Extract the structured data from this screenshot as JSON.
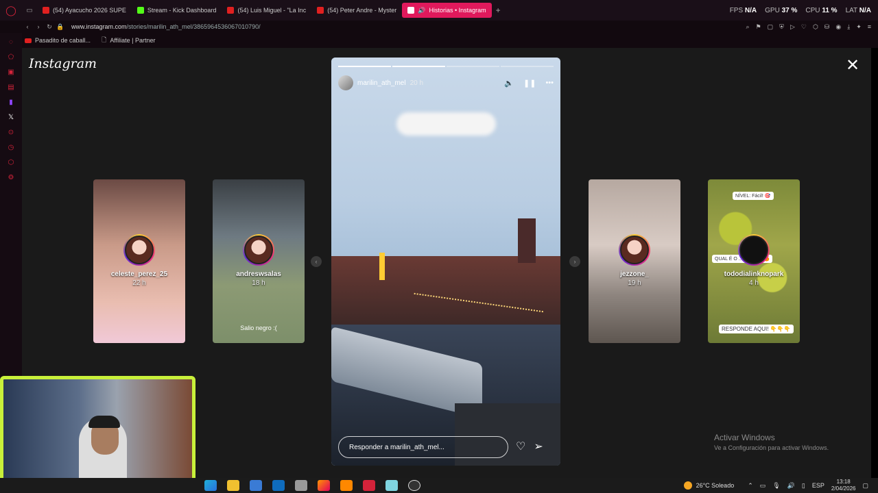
{
  "tabs": [
    {
      "label": "(54) Ayacucho 2026 SUPE",
      "color": "#e02020",
      "active": false
    },
    {
      "label": "Stream - Kick Dashboard",
      "color": "#53fc18",
      "active": false
    },
    {
      "label": "(54) Luis Miguel - \"La Inc",
      "color": "#e02020",
      "active": false
    },
    {
      "label": "(54) Peter Andre - Myster",
      "color": "#e02020",
      "active": false
    },
    {
      "label": "Historias • Instagram",
      "color": "#ffffff",
      "active": true
    }
  ],
  "stats": {
    "fps_label": "FPS",
    "fps": "N/A",
    "gpu_label": "GPU",
    "gpu": "37 %",
    "cpu_label": "CPU",
    "cpu": "11 %",
    "lat_label": "LAT",
    "lat": "N/A"
  },
  "address": {
    "domain": "www.instagram.com",
    "path": "/stories/marilin_ath_mel/3865964536067010790/"
  },
  "bookmarks": [
    "Pasadito de caball...",
    "Affiliate | Partner"
  ],
  "logo": "Instagram",
  "story": {
    "username": "marilin_ath_mel",
    "time": "20 h",
    "progress": [
      1,
      1,
      0,
      0
    ],
    "reply_placeholder": "Responder a marilin_ath_mel..."
  },
  "previews": [
    {
      "username": "celeste_perez_25",
      "time": "22 h",
      "caption": ""
    },
    {
      "username": "andreswsalas",
      "time": "18 h",
      "caption": "Salio negro :("
    },
    {
      "username": "jezzone_",
      "time": "19 h",
      "caption": ""
    },
    {
      "username": "tododialinknopark",
      "time": "4 h",
      "caption": "RESPONDE AQUI! 👇👇👇",
      "tag_top": "NÍVEL: Fácil! 🎯",
      "tag_mid": "QUAL É O ... FRUTA? 🍊"
    }
  ],
  "activate": {
    "title": "Activar Windows",
    "subtitle": "Ve a Configuración para activar Windows."
  },
  "taskbar": {
    "weather": "26°C  Soleado",
    "lang": "ESP",
    "time": "13:18",
    "date": "2/04/2026"
  }
}
